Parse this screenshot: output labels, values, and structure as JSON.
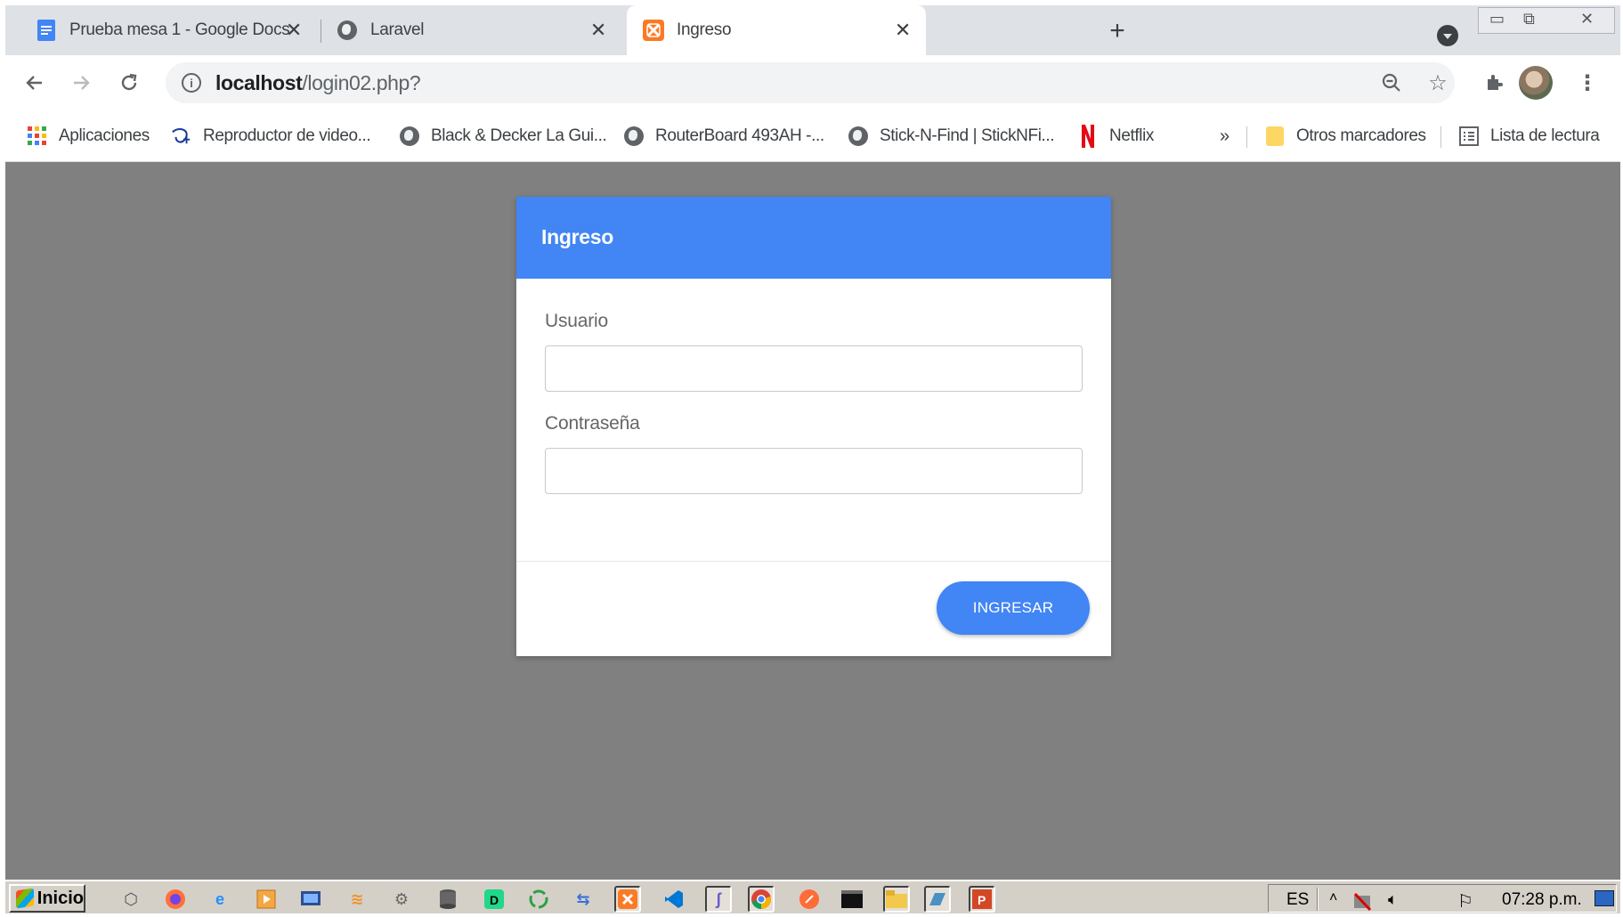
{
  "browser": {
    "tabs": [
      {
        "title": "Prueba mesa 1 - Google Docs",
        "icon": "google-docs-icon",
        "active": false
      },
      {
        "title": "Laravel",
        "icon": "globe-icon",
        "active": false
      },
      {
        "title": "Ingreso",
        "icon": "xampp-icon",
        "active": true
      }
    ],
    "close_glyph": "✕",
    "new_tab_glyph": "+",
    "url_host": "localhost",
    "url_path": "/login02.php?",
    "bookmarks": [
      {
        "label": "Aplicaciones",
        "icon": "apps-grid-icon"
      },
      {
        "label": "Reproductor de video...",
        "icon": "disney-plus-icon"
      },
      {
        "label": "Black & Decker La Gui...",
        "icon": "globe-icon"
      },
      {
        "label": "RouterBoard 493AH -...",
        "icon": "globe-icon"
      },
      {
        "label": "Stick-N-Find | StickNFi...",
        "icon": "globe-icon"
      },
      {
        "label": "Netflix",
        "icon": "netflix-icon"
      }
    ],
    "bookmarks_overflow": "»",
    "other_bookmarks": "Otros marcadores",
    "reading_list": "Lista de lectura"
  },
  "login": {
    "header_title": "Ingreso",
    "user_label": "Usuario",
    "user_value": "",
    "password_label": "Contraseña",
    "password_value": "",
    "submit_label": "INGRESAR"
  },
  "taskbar": {
    "start_label": "Inicio",
    "language": "ES",
    "clock": "07:28 p.m."
  },
  "colors": {
    "accent": "#4285f4",
    "page_background": "#808080"
  }
}
